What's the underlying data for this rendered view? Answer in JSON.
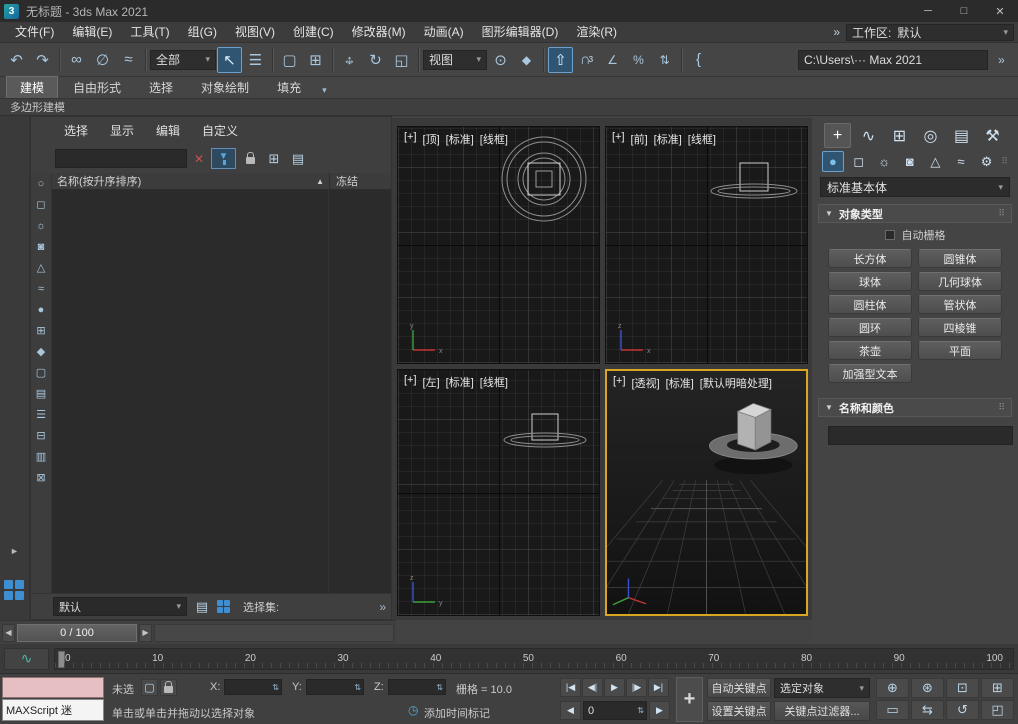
{
  "window": {
    "title": "无标题 - 3ds Max 2021"
  },
  "icons": {
    "logo": "3",
    "minimize": "─",
    "maximize": "□",
    "close": "✕",
    "overflow": "»",
    "dropdown": "▾",
    "undo": "↶",
    "redo": "↷",
    "link": "∞",
    "unlink": "∅",
    "bind_spacewarp": "≈",
    "select_object": "↖",
    "select_by_name": "☰",
    "select_region": "▢",
    "window_crossing": "⊞",
    "move_h": "↔",
    "move_v": "↕",
    "rotate": "↻",
    "scale": "◱",
    "use_center": "⊙",
    "select_manipulate": "◆",
    "snap_toggle": "⇧",
    "magnet": "∩",
    "snap_3": "3",
    "snap_angle": "∠",
    "snap_percent": "%",
    "snap_spinner": "⇅",
    "named_sets": "{",
    "tab_create": "+",
    "tab_modify": "∿",
    "tab_hierarchy": "⊞",
    "tab_motion": "◎",
    "tab_display": "▤",
    "tab_utilities": "⚒",
    "cat_geometry": "●",
    "cat_shapes": "◻",
    "cat_lights": "☼",
    "cat_cameras": "◙",
    "cat_helpers": "△",
    "cat_spacewarps": "≈",
    "cat_systems": "⚙",
    "rollout_open": "▼",
    "grip_dots": "⠿",
    "sort_asc": "▲",
    "clear_search": "✕",
    "funnel": "▼",
    "layer_stack": "▤",
    "expand_right": "►",
    "slider_left": "◀",
    "slider_right": "▶",
    "curve_editor": "∿",
    "clock": "◷",
    "go_start": "|◀",
    "prev_key": "◀|",
    "play": "▶",
    "next_key": "|▶",
    "go_end": "▶|",
    "prev_frame": "◀",
    "next_frame": "▶",
    "spinner": "⇅",
    "big_key": "+",
    "isolate": "▢",
    "zoom": "⊕",
    "zoom_all": "⊛",
    "zoom_extents": "⊡",
    "zoom_extents_all": "⊞",
    "zoom_region": "▭",
    "pan": "⇆",
    "orbit": "↺",
    "maximize_viewport": "◰"
  },
  "menubar": {
    "items": [
      "文件(F)",
      "编辑(E)",
      "工具(T)",
      "组(G)",
      "视图(V)",
      "创建(C)",
      "修改器(M)",
      "动画(A)",
      "图形编辑器(D)",
      "渲染(R)"
    ],
    "workspace_label": "工作区:",
    "workspace_value": "默认"
  },
  "toolbar": {
    "selection_filter": "全部",
    "coord_system": "视图",
    "project_path": "C:\\Users\\··· Max 2021"
  },
  "ribbon": {
    "tabs": [
      "建模",
      "自由形式",
      "选择",
      "对象绘制",
      "填充"
    ],
    "panel_label": "多边形建模"
  },
  "explorer": {
    "menus": [
      "选择",
      "显示",
      "编辑",
      "自定义"
    ],
    "name_header": "名称(按升序排序)",
    "frozen_header": "冻结",
    "preset": "默认",
    "selection_set_label": "选择集:",
    "filter_icons": [
      {
        "name": "display-all",
        "glyph": "○"
      },
      {
        "name": "display-shapes",
        "glyph": "◻"
      },
      {
        "name": "display-lights",
        "glyph": "☼"
      },
      {
        "name": "display-cameras",
        "glyph": "◙"
      },
      {
        "name": "display-helpers",
        "glyph": "△"
      },
      {
        "name": "display-spacewarps",
        "glyph": "≈"
      },
      {
        "name": "display-geometry",
        "glyph": "●"
      },
      {
        "name": "display-groups",
        "glyph": "⊞"
      },
      {
        "name": "display-xrefs",
        "glyph": "◆"
      },
      {
        "name": "display-bones",
        "glyph": "▢"
      },
      {
        "name": "display-containers",
        "glyph": "▤"
      },
      {
        "name": "display-materials",
        "glyph": "☰"
      },
      {
        "name": "display-frozen",
        "glyph": "⊟"
      },
      {
        "name": "display-hidden",
        "glyph": "▥"
      },
      {
        "name": "display-selection-sets",
        "glyph": "⊠"
      }
    ]
  },
  "viewports": {
    "top": {
      "menu": "[+]",
      "view": "[顶]",
      "pov": "[标准]",
      "shading": "[线框]"
    },
    "front": {
      "menu": "[+]",
      "view": "[前]",
      "pov": "[标准]",
      "shading": "[线框]"
    },
    "left": {
      "menu": "[+]",
      "view": "[左]",
      "pov": "[标准]",
      "shading": "[线框]"
    },
    "perspective": {
      "menu": "[+]",
      "view": "[透视]",
      "pov": "[标准]",
      "shading": "[默认明暗处理]"
    }
  },
  "command_panel": {
    "category": "标准基本体",
    "object_type_rollout": "对象类型",
    "autogrid": "自动栅格",
    "buttons": [
      "长方体",
      "圆锥体",
      "球体",
      "几何球体",
      "圆柱体",
      "管状体",
      "圆环",
      "四棱锥",
      "茶壶",
      "平面",
      "加强型文本"
    ],
    "name_color_rollout": "名称和颜色",
    "object_color": "#e0218a"
  },
  "timeslider": {
    "value": "0 / 100"
  },
  "timeline": {
    "ticks": [
      "0",
      "10",
      "20",
      "30",
      "40",
      "50",
      "60",
      "70",
      "80",
      "90",
      "100"
    ]
  },
  "statusbar": {
    "maxscript_text": "MAXScript 迷",
    "selection_status": "未选",
    "x_label": "X:",
    "y_label": "Y:",
    "z_label": "Z:",
    "grid_size": "栅格 = 10.0",
    "prompt": "单击或单击并拖动以选择对象",
    "add_time_tag": "添加时间标记",
    "frame": "0",
    "auto_key": "自动关键点",
    "set_key": "设置关键点",
    "selected_filter": "选定对象",
    "key_filters": "关键点过滤器..."
  }
}
